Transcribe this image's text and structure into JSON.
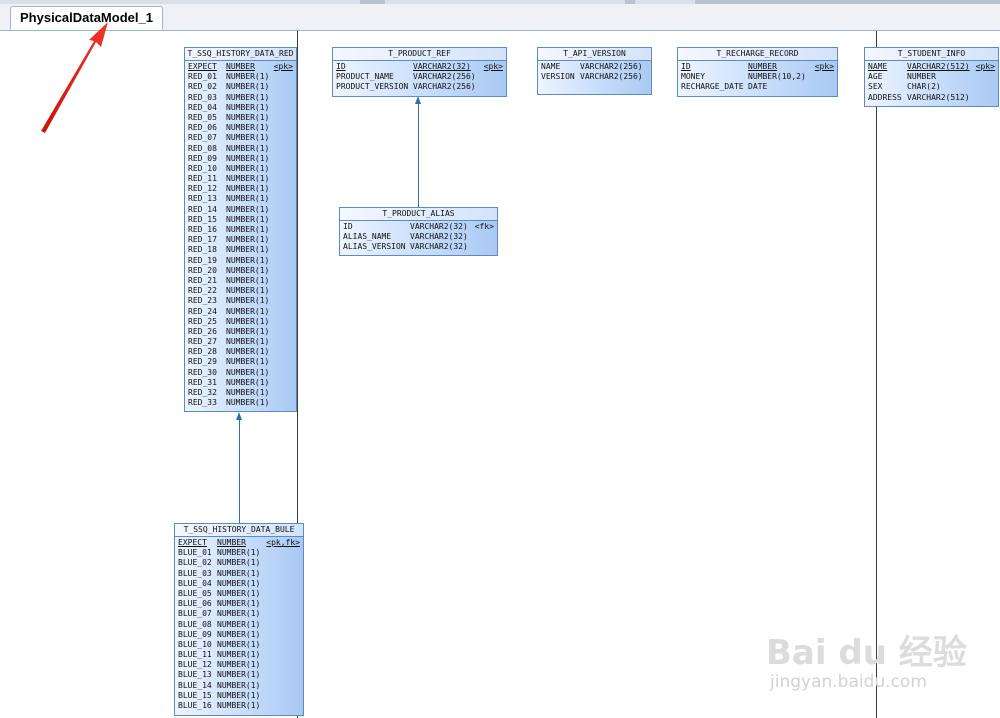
{
  "tab": {
    "label": "PhysicalDataModel_1"
  },
  "tables": [
    {
      "id": "red",
      "title": "T_SSQ_HISTORY_DATA_RED",
      "rows": [
        {
          "name": "EXPECT",
          "type": "NUMBER",
          "key": "<pk>",
          "u": true
        },
        {
          "name": "RED_01",
          "type": "NUMBER(1)"
        },
        {
          "name": "RED_02",
          "type": "NUMBER(1)"
        },
        {
          "name": "RED_03",
          "type": "NUMBER(1)"
        },
        {
          "name": "RED_04",
          "type": "NUMBER(1)"
        },
        {
          "name": "RED_05",
          "type": "NUMBER(1)"
        },
        {
          "name": "RED_06",
          "type": "NUMBER(1)"
        },
        {
          "name": "RED_07",
          "type": "NUMBER(1)"
        },
        {
          "name": "RED_08",
          "type": "NUMBER(1)"
        },
        {
          "name": "RED_09",
          "type": "NUMBER(1)"
        },
        {
          "name": "RED_10",
          "type": "NUMBER(1)"
        },
        {
          "name": "RED_11",
          "type": "NUMBER(1)"
        },
        {
          "name": "RED_12",
          "type": "NUMBER(1)"
        },
        {
          "name": "RED_13",
          "type": "NUMBER(1)"
        },
        {
          "name": "RED_14",
          "type": "NUMBER(1)"
        },
        {
          "name": "RED_15",
          "type": "NUMBER(1)"
        },
        {
          "name": "RED_16",
          "type": "NUMBER(1)"
        },
        {
          "name": "RED_17",
          "type": "NUMBER(1)"
        },
        {
          "name": "RED_18",
          "type": "NUMBER(1)"
        },
        {
          "name": "RED_19",
          "type": "NUMBER(1)"
        },
        {
          "name": "RED_20",
          "type": "NUMBER(1)"
        },
        {
          "name": "RED_21",
          "type": "NUMBER(1)"
        },
        {
          "name": "RED_22",
          "type": "NUMBER(1)"
        },
        {
          "name": "RED_23",
          "type": "NUMBER(1)"
        },
        {
          "name": "RED_24",
          "type": "NUMBER(1)"
        },
        {
          "name": "RED_25",
          "type": "NUMBER(1)"
        },
        {
          "name": "RED_26",
          "type": "NUMBER(1)"
        },
        {
          "name": "RED_27",
          "type": "NUMBER(1)"
        },
        {
          "name": "RED_28",
          "type": "NUMBER(1)"
        },
        {
          "name": "RED_29",
          "type": "NUMBER(1)"
        },
        {
          "name": "RED_30",
          "type": "NUMBER(1)"
        },
        {
          "name": "RED_31",
          "type": "NUMBER(1)"
        },
        {
          "name": "RED_32",
          "type": "NUMBER(1)"
        },
        {
          "name": "RED_33",
          "type": "NUMBER(1)"
        }
      ]
    },
    {
      "id": "product_ref",
      "title": "T_PRODUCT_REF",
      "rows": [
        {
          "name": "ID",
          "type": "VARCHAR2(32)",
          "key": "<pk>",
          "u": true
        },
        {
          "name": "PRODUCT_NAME",
          "type": "VARCHAR2(256)"
        },
        {
          "name": "PRODUCT_VERSION",
          "type": "VARCHAR2(256)"
        }
      ]
    },
    {
      "id": "api_version",
      "title": "T_API_VERSION",
      "rows": [
        {
          "name": "NAME",
          "type": "VARCHAR2(256)"
        },
        {
          "name": "VERSION",
          "type": "VARCHAR2(256)"
        }
      ]
    },
    {
      "id": "recharge",
      "title": "T_RECHARGE_RECORD",
      "rows": [
        {
          "name": "ID",
          "type": "NUMBER",
          "key": "<pk>",
          "u": true
        },
        {
          "name": "MONEY",
          "type": "NUMBER(10,2)"
        },
        {
          "name": "RECHARGE_DATE",
          "type": "DATE"
        }
      ]
    },
    {
      "id": "student",
      "title": "T_STUDENT_INFO",
      "rows": [
        {
          "name": "NAME",
          "type": "VARCHAR2(512)",
          "key": "<pk>",
          "u": true
        },
        {
          "name": "AGE",
          "type": "NUMBER"
        },
        {
          "name": "SEX",
          "type": "CHAR(2)"
        },
        {
          "name": "ADDRESS",
          "type": "VARCHAR2(512)"
        }
      ]
    },
    {
      "id": "product_alias",
      "title": "T_PRODUCT_ALIAS",
      "rows": [
        {
          "name": "ID",
          "type": "VARCHAR2(32)",
          "key": "<fk>"
        },
        {
          "name": "ALIAS_NAME",
          "type": "VARCHAR2(32)"
        },
        {
          "name": "ALIAS_VERSION",
          "type": "VARCHAR2(32)"
        }
      ]
    },
    {
      "id": "blue",
      "title": "T_SSQ_HISTORY_DATA_BULE",
      "rows": [
        {
          "name": "EXPECT",
          "type": "NUMBER",
          "key": "<pk,fk>",
          "u": true
        },
        {
          "name": "BLUE_01",
          "type": "NUMBER(1)"
        },
        {
          "name": "BLUE_02",
          "type": "NUMBER(1)"
        },
        {
          "name": "BLUE_03",
          "type": "NUMBER(1)"
        },
        {
          "name": "BLUE_04",
          "type": "NUMBER(1)"
        },
        {
          "name": "BLUE_05",
          "type": "NUMBER(1)"
        },
        {
          "name": "BLUE_06",
          "type": "NUMBER(1)"
        },
        {
          "name": "BLUE_07",
          "type": "NUMBER(1)"
        },
        {
          "name": "BLUE_08",
          "type": "NUMBER(1)"
        },
        {
          "name": "BLUE_09",
          "type": "NUMBER(1)"
        },
        {
          "name": "BLUE_10",
          "type": "NUMBER(1)"
        },
        {
          "name": "BLUE_11",
          "type": "NUMBER(1)"
        },
        {
          "name": "BLUE_12",
          "type": "NUMBER(1)"
        },
        {
          "name": "BLUE_13",
          "type": "NUMBER(1)"
        },
        {
          "name": "BLUE_14",
          "type": "NUMBER(1)"
        },
        {
          "name": "BLUE_15",
          "type": "NUMBER(1)"
        },
        {
          "name": "BLUE_16",
          "type": "NUMBER(1)"
        }
      ]
    }
  ],
  "watermark": {
    "brand": "Bai du 经验",
    "url": "jingyan.baidu.com"
  },
  "colors": {
    "entity_border": "#5b8ac4",
    "connector": "#2f6fb1",
    "annotation_arrow": "#e3211c"
  }
}
